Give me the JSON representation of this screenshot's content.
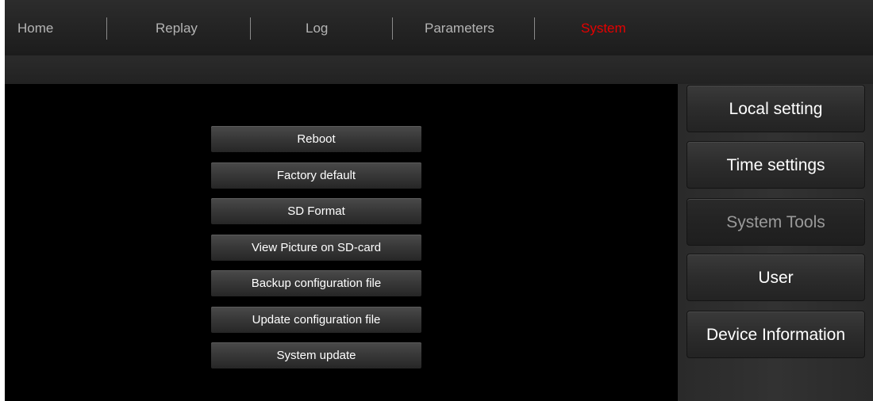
{
  "nav": {
    "items": [
      {
        "label": "Home"
      },
      {
        "label": "Replay"
      },
      {
        "label": "Log"
      },
      {
        "label": "Parameters"
      },
      {
        "label": "System",
        "active": true
      }
    ]
  },
  "tools": {
    "buttons": [
      {
        "label": "Reboot"
      },
      {
        "label": "Factory default"
      },
      {
        "label": "SD Format"
      },
      {
        "label": "View Picture on SD-card"
      },
      {
        "label": "Backup configuration file"
      },
      {
        "label": "Update configuration file"
      },
      {
        "label": "System update"
      }
    ]
  },
  "sidebar": {
    "items": [
      {
        "label": "Local setting"
      },
      {
        "label": "Time settings"
      },
      {
        "label": "System Tools",
        "active": true
      },
      {
        "label": "User"
      },
      {
        "label": "Device Information"
      }
    ]
  },
  "colors": {
    "accent_active_nav": "#e60000",
    "background": "#000000",
    "nav_text": "#b4b4b4"
  }
}
